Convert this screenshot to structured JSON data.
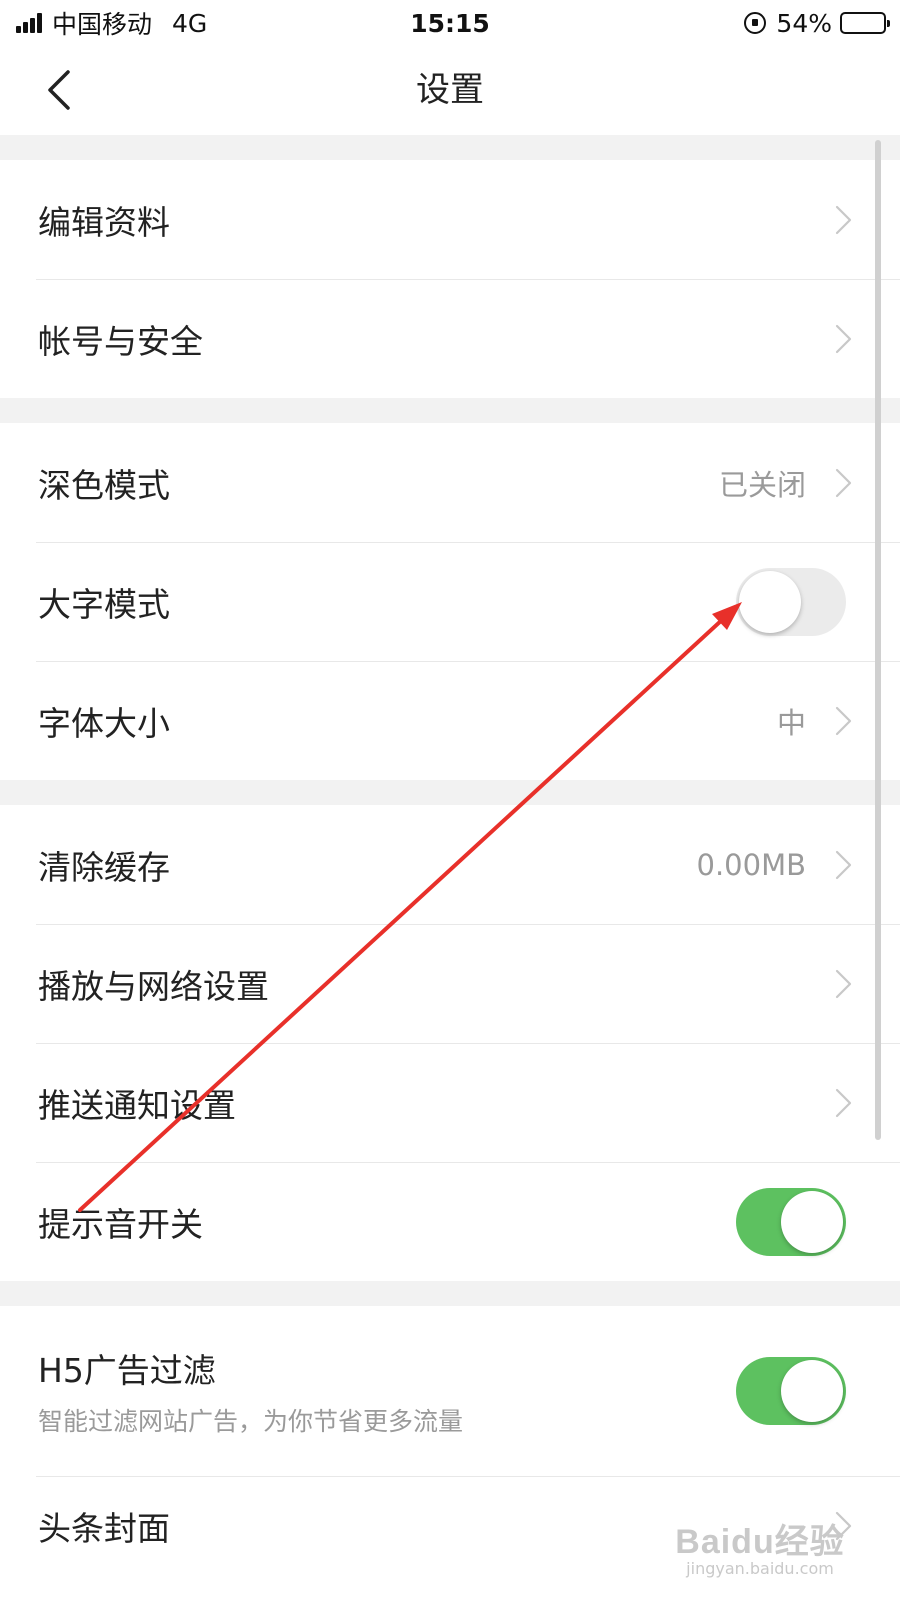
{
  "status_bar": {
    "carrier": "中国移动",
    "network": "4G",
    "time": "15:15",
    "battery_percent": "54%",
    "battery_level": 0.54
  },
  "nav": {
    "title": "设置",
    "back_icon": "chevron-left-icon"
  },
  "sections": [
    {
      "rows": [
        {
          "label": "编辑资料",
          "type": "chevron"
        },
        {
          "label": "帐号与安全",
          "type": "chevron"
        }
      ]
    },
    {
      "rows": [
        {
          "label": "深色模式",
          "value": "已关闭",
          "type": "chevron"
        },
        {
          "label": "大字模式",
          "type": "toggle",
          "on": false
        },
        {
          "label": "字体大小",
          "value": "中",
          "type": "chevron"
        }
      ]
    },
    {
      "rows": [
        {
          "label": "清除缓存",
          "value": "0.00MB",
          "type": "chevron"
        },
        {
          "label": "播放与网络设置",
          "type": "chevron"
        },
        {
          "label": "推送通知设置",
          "type": "chevron"
        },
        {
          "label": "提示音开关",
          "type": "toggle",
          "on": true
        }
      ]
    },
    {
      "rows": [
        {
          "label": "H5广告过滤",
          "sublabel": "智能过滤网站广告，为你节省更多流量",
          "type": "toggle",
          "on": true
        },
        {
          "label": "头条封面",
          "type": "chevron"
        }
      ]
    }
  ],
  "colors": {
    "toggle_on": "#5dc160",
    "toggle_off": "#ebebeb",
    "annotation": "#e8302a",
    "section_gap": "#f2f2f2"
  },
  "watermark": {
    "logo": "Baidu经验",
    "url": "jingyan.baidu.com"
  }
}
